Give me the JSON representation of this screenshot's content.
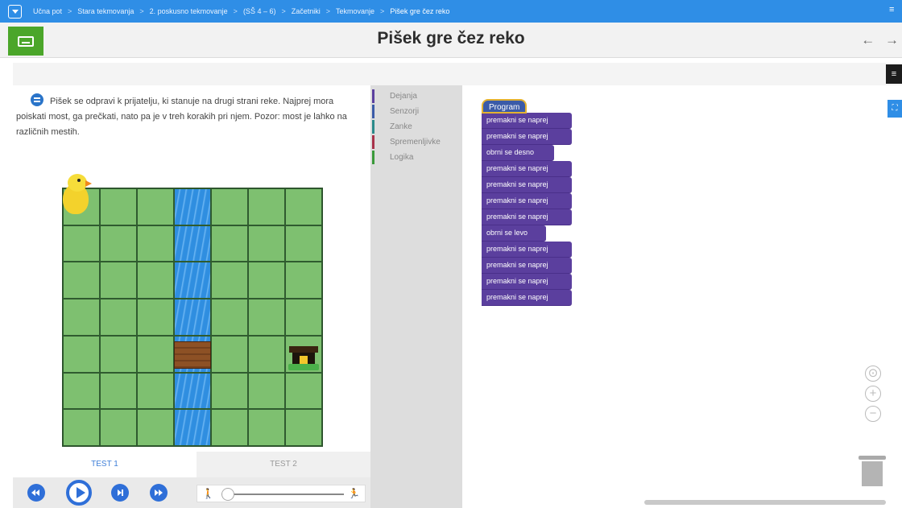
{
  "breadcrumb": {
    "items": [
      "Učna pot",
      "Stara tekmovanja",
      "2. poskusno tekmovanje",
      "(SŠ 4 – 6)",
      "Začetniki",
      "Tekmovanje",
      "Pišek gre čez reko"
    ],
    "separator": ">"
  },
  "header": {
    "title": "Pišek gre čez reko",
    "nav_arrows": "← →"
  },
  "task": {
    "text": "Pišek se odpravi k prijatelju, ki stanuje na drugi strani reke. Najprej mora poiskati most, ga prečkati, nato pa je v treh korakih pri njem. Pozor: most je lahko na različnih mestih."
  },
  "grid": {
    "columns": 7,
    "rows": 7,
    "water_column": 4,
    "bridge_row": 5,
    "chick_position": [
      1,
      1
    ],
    "house_position": [
      7,
      5
    ]
  },
  "tests": {
    "tabs": [
      "TEST 1",
      "TEST 2"
    ],
    "active": 0
  },
  "player": {
    "speed_slow_icon": "walk-slow-icon",
    "speed_fast_icon": "run-fast-icon",
    "speed_slow_glyph": "🚶",
    "speed_fast_glyph": "🏃",
    "speed_level": 0
  },
  "toolbox": {
    "categories": [
      {
        "label": "Dejanja",
        "color": "#5b3f9e"
      },
      {
        "label": "Senzorji",
        "color": "#3b5ba8"
      },
      {
        "label": "Zanke",
        "color": "#2a8a8a"
      },
      {
        "label": "Spremenljivke",
        "color": "#a8324a"
      },
      {
        "label": "Logika",
        "color": "#3a9a3a"
      }
    ]
  },
  "workspace": {
    "program_label": "Program",
    "blocks": [
      "premakni se naprej",
      "premakni se naprej",
      "obrni se desno",
      "premakni se naprej",
      "premakni se naprej",
      "premakni se naprej",
      "premakni se naprej",
      "obrni se levo",
      "premakni se naprej",
      "premakni se naprej",
      "premakni se naprej",
      "premakni se naprej"
    ],
    "zoom_controls": [
      "⊙",
      "+",
      "−"
    ]
  },
  "colors": {
    "accent_blue": "#2f8ee6",
    "title_green": "#4ba62a",
    "action_purple": "#5b3f9e",
    "grass": "#7ec070",
    "water": "#2f8ee0"
  }
}
